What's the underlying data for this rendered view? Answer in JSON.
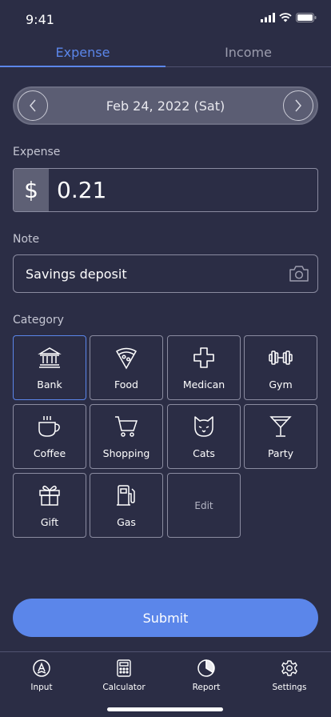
{
  "status_bar": {
    "time": "9:41"
  },
  "tabs": [
    {
      "label": "Expense",
      "active": true
    },
    {
      "label": "Income",
      "active": false
    }
  ],
  "date": {
    "text": "Feb 24, 2022 (Sat)"
  },
  "expense": {
    "label": "Expense",
    "currency": "$",
    "amount": "0.21"
  },
  "note": {
    "label": "Note",
    "value": "Savings deposit"
  },
  "category": {
    "label": "Category",
    "items": [
      {
        "label": "Bank",
        "icon": "bank-icon"
      },
      {
        "label": "Food",
        "icon": "pizza-icon"
      },
      {
        "label": "Medican",
        "icon": "medical-cross-icon"
      },
      {
        "label": "Gym",
        "icon": "dumbbell-icon"
      },
      {
        "label": "Coffee",
        "icon": "coffee-icon"
      },
      {
        "label": "Shopping",
        "icon": "cart-icon"
      },
      {
        "label": "Cats",
        "icon": "cat-icon"
      },
      {
        "label": "Party",
        "icon": "cocktail-icon"
      },
      {
        "label": "Gift",
        "icon": "gift-icon"
      },
      {
        "label": "Gas",
        "icon": "gas-pump-icon"
      },
      {
        "label": "Edit"
      }
    ]
  },
  "submit": {
    "label": "Submit"
  },
  "bottom_nav": [
    {
      "label": "Input",
      "icon": "input-icon"
    },
    {
      "label": "Calculator",
      "icon": "calculator-icon"
    },
    {
      "label": "Report",
      "icon": "pie-chart-icon"
    },
    {
      "label": "Settings",
      "icon": "gear-icon"
    }
  ],
  "colors": {
    "background": "#2b2d45",
    "accent": "#5b86ea",
    "border": "#8a8ba0"
  }
}
